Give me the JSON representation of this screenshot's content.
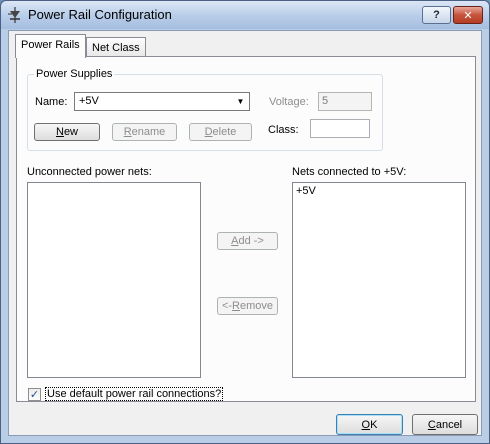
{
  "window": {
    "title": "Power Rail Configuration",
    "help_button": "?",
    "close_button": "✕"
  },
  "tabs": [
    {
      "label": "Power Rails",
      "active": true
    },
    {
      "label": "Net Class",
      "active": false
    }
  ],
  "power_supplies": {
    "group_label": "Power Supplies",
    "name_label": "Name:",
    "name_value": "+5V",
    "voltage_label": "Voltage:",
    "voltage_value": "5",
    "class_label": "Class:",
    "class_value": "",
    "buttons": {
      "new": {
        "prefix": "",
        "accel": "N",
        "rest": "ew"
      },
      "rename": {
        "prefix": "",
        "accel": "R",
        "rest": "ename"
      },
      "delete": {
        "prefix": "",
        "accel": "D",
        "rest": "elete"
      }
    }
  },
  "unconnected": {
    "label": "Unconnected power nets:",
    "items": []
  },
  "connected": {
    "label": "Nets connected to +5V:",
    "items": [
      "+5V"
    ]
  },
  "transfer": {
    "add": {
      "accel": "A",
      "rest": "dd ->"
    },
    "remove": {
      "prefix": "<- ",
      "accel": "R",
      "rest": "emove"
    }
  },
  "default_connections": {
    "checked": true,
    "check_mark": "✓",
    "label": "Use default power rail connections?"
  },
  "footer": {
    "ok": {
      "accel": "O",
      "rest": "K"
    },
    "cancel": {
      "accel": "C",
      "rest": "ancel"
    }
  },
  "colors": {
    "title_bar": "#b7cce8",
    "close_button": "#c8533d",
    "dialog_bg": "#f0f0f0",
    "panel_bg": "#fcfcfc",
    "default_button_border": "#3c7fb1"
  }
}
